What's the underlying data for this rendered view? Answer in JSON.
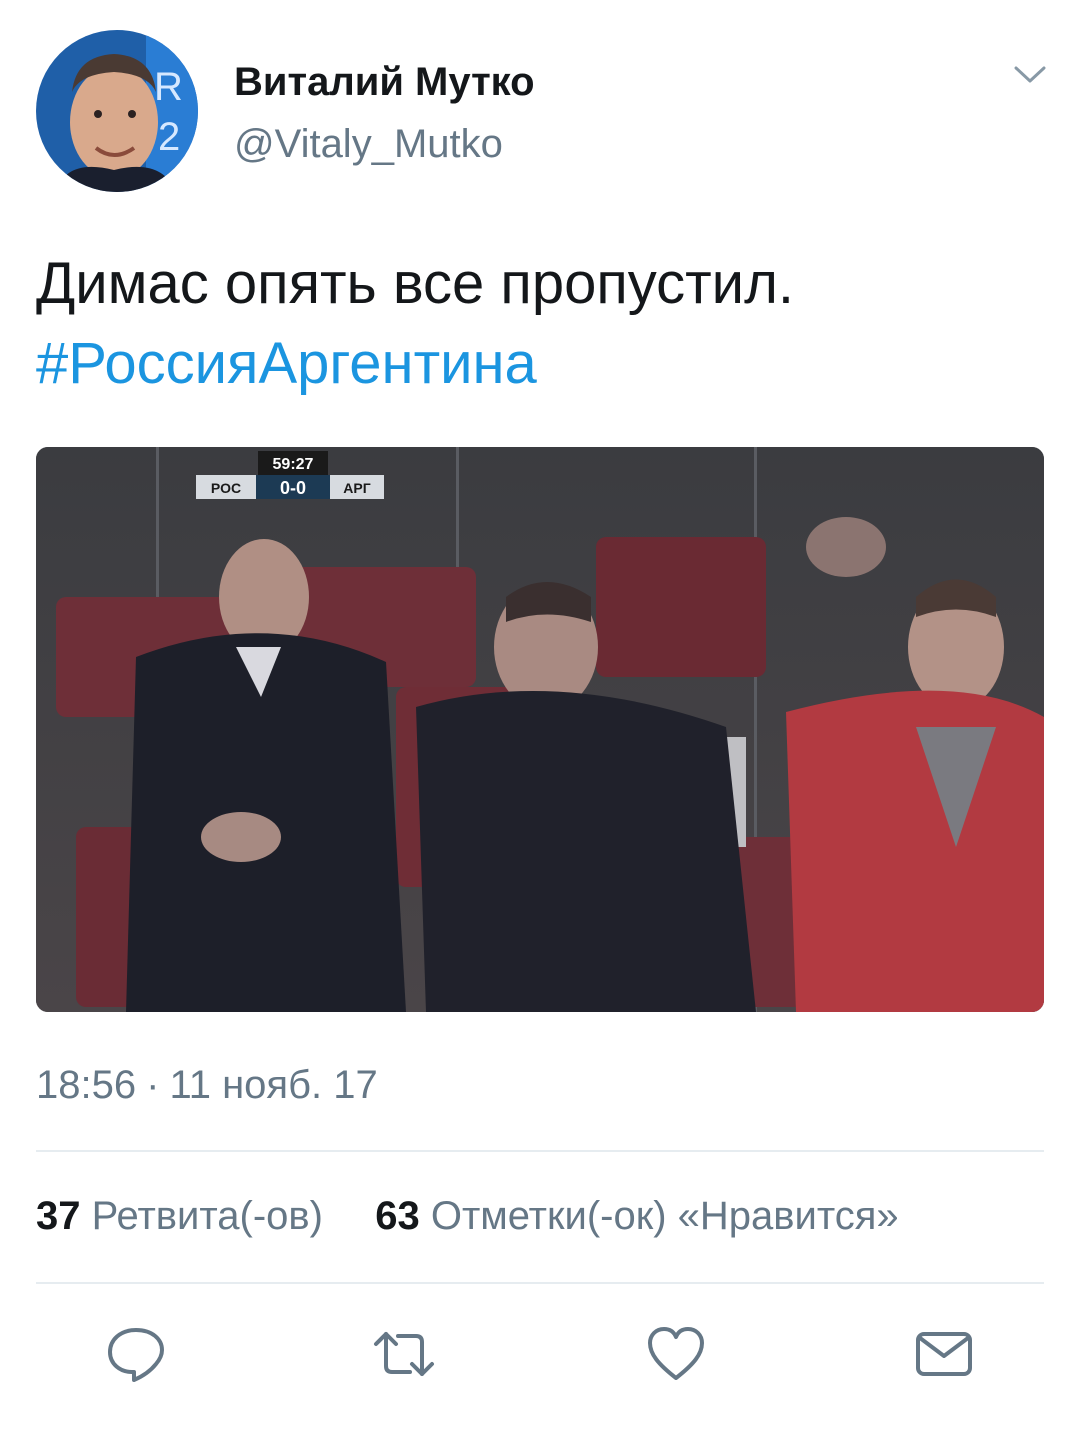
{
  "author": {
    "display_name": "Виталий Мутко",
    "handle": "@Vitaly_Mutko"
  },
  "tweet": {
    "text": "Димас опять все пропустил.",
    "hashtag": "#РоссияАргентина"
  },
  "media": {
    "scoreboard": {
      "clock": "59:27",
      "home": "РОС",
      "score": "0-0",
      "away": "АРГ"
    }
  },
  "meta": {
    "time": "18:56",
    "separator": "·",
    "date": "11 нояб. 17"
  },
  "stats": {
    "retweets_count": "37",
    "retweets_label": "Ретвита(-ов)",
    "likes_count": "63",
    "likes_label": "Отметки(-ок) «Нравится»"
  },
  "actions": [
    "reply-icon",
    "retweet-icon",
    "like-icon",
    "message-icon"
  ],
  "colors": {
    "link": "#1b95e0",
    "secondary_text": "#657786",
    "icon": "#657786",
    "divider": "#e6ecf0"
  }
}
